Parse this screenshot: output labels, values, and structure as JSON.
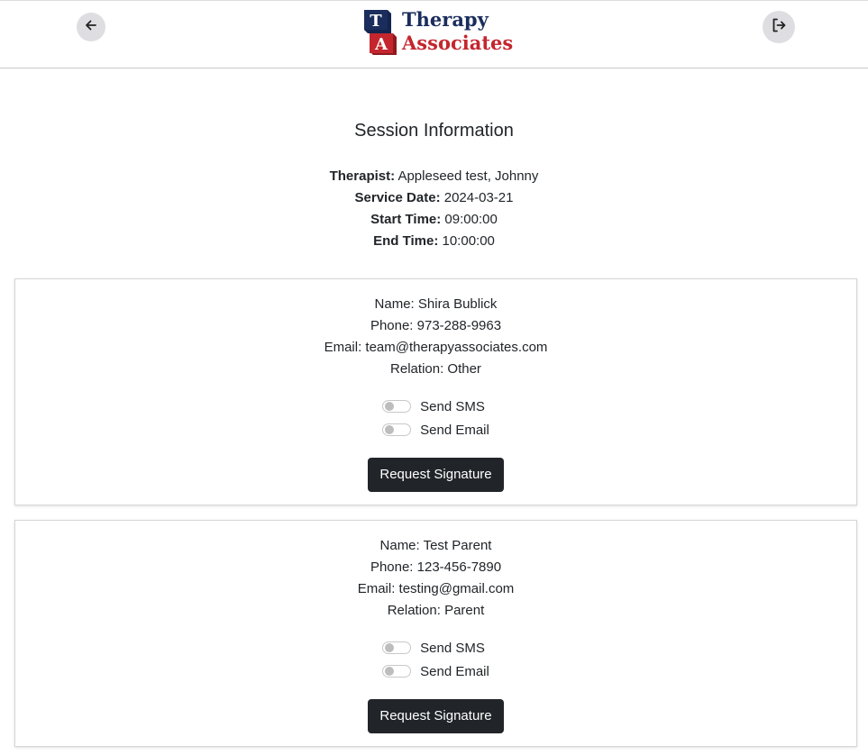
{
  "header": {
    "back_icon": "arrow-left-icon",
    "logout_icon": "logout-icon",
    "logo": {
      "block_top": "T",
      "block_bottom": "A",
      "line1": "Therapy",
      "line2": "Associates",
      "colors": {
        "navy": "#1b2d5c",
        "red": "#c4262e"
      }
    }
  },
  "session": {
    "title": "Session Information",
    "therapist_label": "Therapist:",
    "therapist_value": "Appleseed test, Johnny",
    "service_date_label": "Service Date:",
    "service_date_value": "2024-03-21",
    "start_time_label": "Start Time:",
    "start_time_value": "09:00:00",
    "end_time_label": "End Time:",
    "end_time_value": "10:00:00"
  },
  "contacts": [
    {
      "name": "Name: Shira Bublick",
      "phone": "Phone: 973-288-9963",
      "email": "Email: team@therapyassociates.com",
      "relation": "Relation: Other",
      "sms_label": "Send SMS",
      "sms_on": false,
      "email_toggle_label": "Send Email",
      "email_on": false,
      "button_label": "Request Signature"
    },
    {
      "name": "Name: Test Parent",
      "phone": "Phone: 123-456-7890",
      "email": "Email: testing@gmail.com",
      "relation": "Relation: Parent",
      "sms_label": "Send SMS",
      "sms_on": false,
      "email_toggle_label": "Send Email",
      "email_on": false,
      "button_label": "Request Signature"
    }
  ],
  "colors": {
    "button_bg": "#212529",
    "icon_button_bg": "#dedee2"
  }
}
